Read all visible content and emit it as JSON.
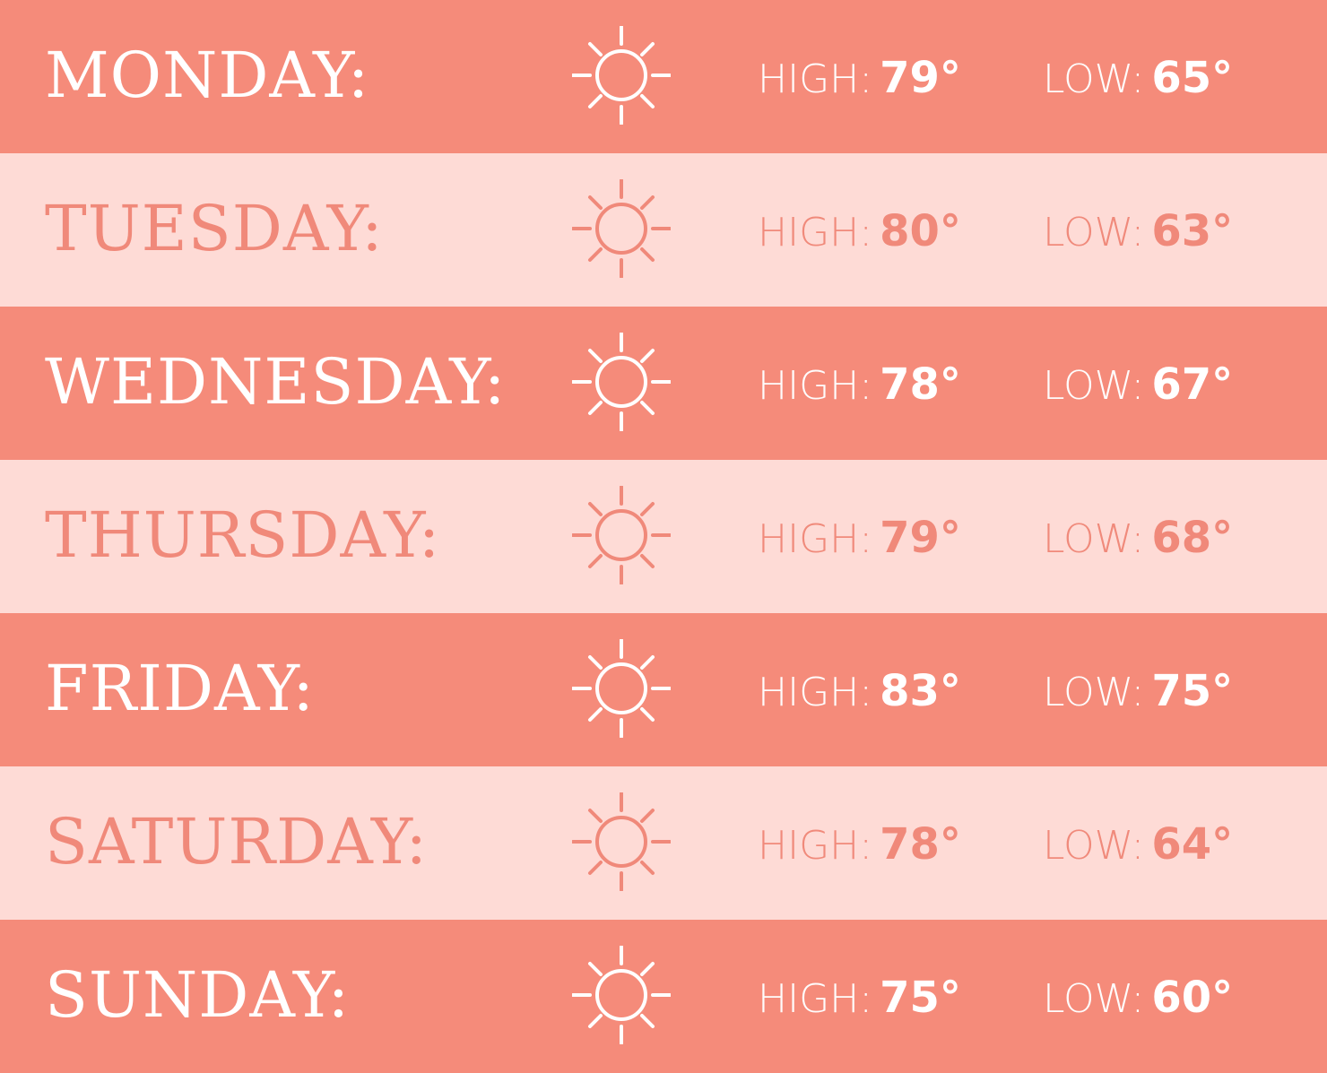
{
  "colors": {
    "dark_row": "#f58b7a",
    "light_row": "#fedbd6",
    "dark_text": "#ffffff",
    "light_text": "#f0897a"
  },
  "labels": {
    "high": "HIGH:",
    "low": "LOW:"
  },
  "days": [
    {
      "name": "MONDAY:",
      "icon": "sun-icon",
      "high": "79°",
      "low": "65°",
      "style": "dark"
    },
    {
      "name": "TUESDAY:",
      "icon": "sun-icon",
      "high": "80°",
      "low": "63°",
      "style": "light"
    },
    {
      "name": "WEDNESDAY:",
      "icon": "sun-icon",
      "high": "78°",
      "low": "67°",
      "style": "dark"
    },
    {
      "name": "THURSDAY:",
      "icon": "sun-icon",
      "high": "79°",
      "low": "68°",
      "style": "light"
    },
    {
      "name": "FRIDAY:",
      "icon": "sun-icon",
      "high": "83°",
      "low": "75°",
      "style": "dark"
    },
    {
      "name": "SATURDAY:",
      "icon": "sun-icon",
      "high": "78°",
      "low": "64°",
      "style": "light"
    },
    {
      "name": "SUNDAY:",
      "icon": "sun-icon",
      "high": "75°",
      "low": "60°",
      "style": "dark"
    }
  ]
}
